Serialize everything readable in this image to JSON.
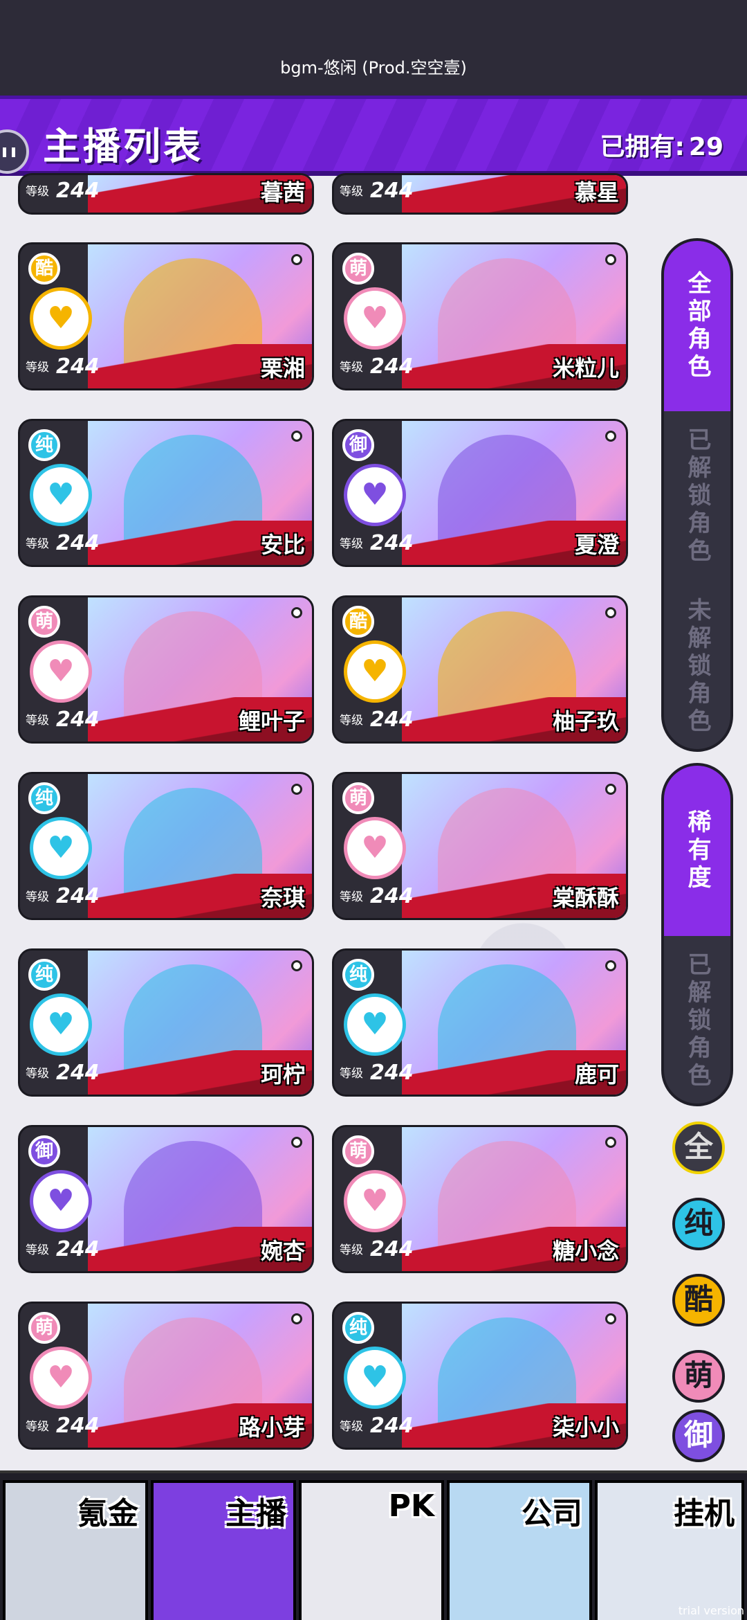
{
  "top": {
    "bgm": "bgm-悠闲 (Prod.空空壹)"
  },
  "header": {
    "title": "主播列表",
    "owned_label": "已拥有:",
    "owned_count": "29"
  },
  "level_label": "等级",
  "partial_cards": [
    {
      "name": "暮茜",
      "level": "244"
    },
    {
      "name": "慕星",
      "level": "244"
    }
  ],
  "cards": [
    {
      "name": "栗湘",
      "level": "244",
      "type": "酷"
    },
    {
      "name": "米粒儿",
      "level": "244",
      "type": "萌"
    },
    {
      "name": "安比",
      "level": "244",
      "type": "纯"
    },
    {
      "name": "夏澄",
      "level": "244",
      "type": "御"
    },
    {
      "name": "鲤叶子",
      "level": "244",
      "type": "萌"
    },
    {
      "name": "柚子玖",
      "level": "244",
      "type": "酷"
    },
    {
      "name": "奈琪",
      "level": "244",
      "type": "纯"
    },
    {
      "name": "棠酥酥",
      "level": "244",
      "type": "萌"
    },
    {
      "name": "珂柠",
      "level": "244",
      "type": "纯"
    },
    {
      "name": "鹿可",
      "level": "244",
      "type": "纯"
    },
    {
      "name": "婉杏",
      "level": "244",
      "type": "御"
    },
    {
      "name": "糖小念",
      "level": "244",
      "type": "萌"
    },
    {
      "name": "路小芽",
      "level": "244",
      "type": "萌"
    },
    {
      "name": "柒小小",
      "level": "244",
      "type": "纯"
    }
  ],
  "filters": {
    "group1": [
      "全部角色",
      "已解锁角色",
      "未解锁角色"
    ],
    "group2": [
      "稀有度",
      "已解锁角色"
    ]
  },
  "rarity_buttons": [
    "全",
    "纯",
    "酷",
    "萌",
    "御"
  ],
  "type_colors": {
    "纯": "#2ec3e6",
    "酷": "#f5b400",
    "萌": "#f08bb8",
    "御": "#7e4fe0"
  },
  "nav": [
    "氪金",
    "主播",
    "PK",
    "公司",
    "挂机"
  ],
  "watermark": "trial version"
}
